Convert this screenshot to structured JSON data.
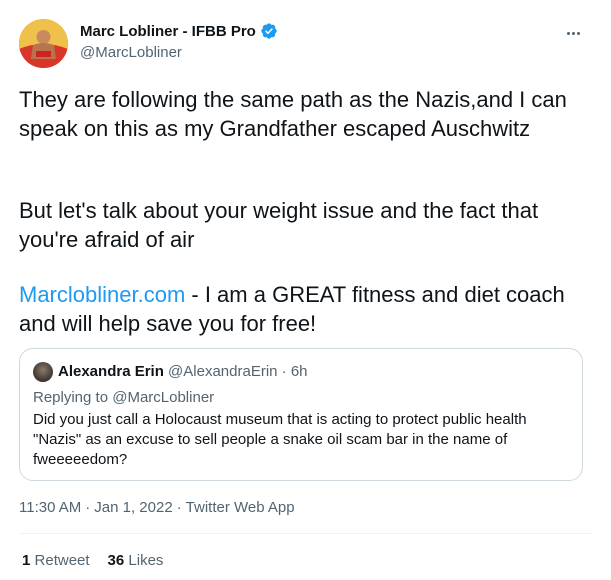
{
  "author": {
    "name": "Marc Lobliner - IFBB Pro",
    "handle": "@MarcLobliner",
    "verified": true
  },
  "tweet": {
    "paragraph1": "They are following the same path as the Nazis,and I can speak on this as my Grandfather escaped Auschwitz",
    "paragraph2": "But let's talk about your weight issue and the fact that you're afraid of air",
    "link_text": "Marclobliner.com",
    "paragraph3_rest": " - I am a GREAT fitness and diet coach and will help save you for free!"
  },
  "quote": {
    "name": "Alexandra Erin",
    "handle": "@AlexandraErin",
    "separator": "·",
    "time": "6h",
    "replying_prefix": "Replying to",
    "replying_to": "@MarcLobliner",
    "text": "Did you just call a Holocaust museum that is acting to protect public health \"Nazis\" as an excuse to sell people a snake oil scam bar in the name of fweeeeedom?"
  },
  "meta": {
    "time": "11:30 AM",
    "date": "Jan 1, 2022",
    "source": "Twitter Web App",
    "separator": "·"
  },
  "stats": {
    "retweets_count": "1",
    "retweets_label": "Retweet",
    "likes_count": "36",
    "likes_label": "Likes"
  },
  "colors": {
    "link": "#1d9bf0",
    "secondary_text": "#536471",
    "verified_badge": "#1d9bf0"
  },
  "icons": [
    "verified-badge-icon",
    "more-options-icon"
  ]
}
